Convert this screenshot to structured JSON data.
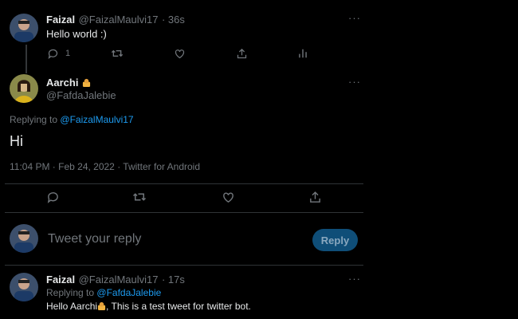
{
  "tweet1": {
    "name": "Faizal",
    "handle": "@FaizalMaulvi17",
    "time": "· 36s",
    "text": "Hello world :)",
    "reply_count": "1",
    "more": "···"
  },
  "tweet2": {
    "name": "Aarchi",
    "handle": "@FafdaJalebie",
    "replying_prefix": "Replying to",
    "replying_to": "@FaizalMaulvi17",
    "text": "Hi",
    "meta": "11:04 PM · Feb 24, 2022 · Twitter for Android",
    "more": "···"
  },
  "composer": {
    "placeholder": "Tweet your reply",
    "reply_label": "Reply"
  },
  "tweet3": {
    "name": "Faizal",
    "handle": "@FaizalMaulvi17",
    "time": "· 17s",
    "replying_prefix": "Replying to",
    "replying_to": "@FafdaJalebie",
    "text_before": "Hello Aarchi",
    "text_after": ", This is a test tweet for twitter bot.",
    "more": "···"
  },
  "colors": {
    "background": "#000000",
    "text": "#e7e9ea",
    "muted": "#71767b",
    "link": "#1d9bf0",
    "reply_button": "#0f4e78"
  },
  "icons": [
    "reply-icon",
    "retweet-icon",
    "like-icon",
    "share-icon",
    "analytics-icon"
  ]
}
